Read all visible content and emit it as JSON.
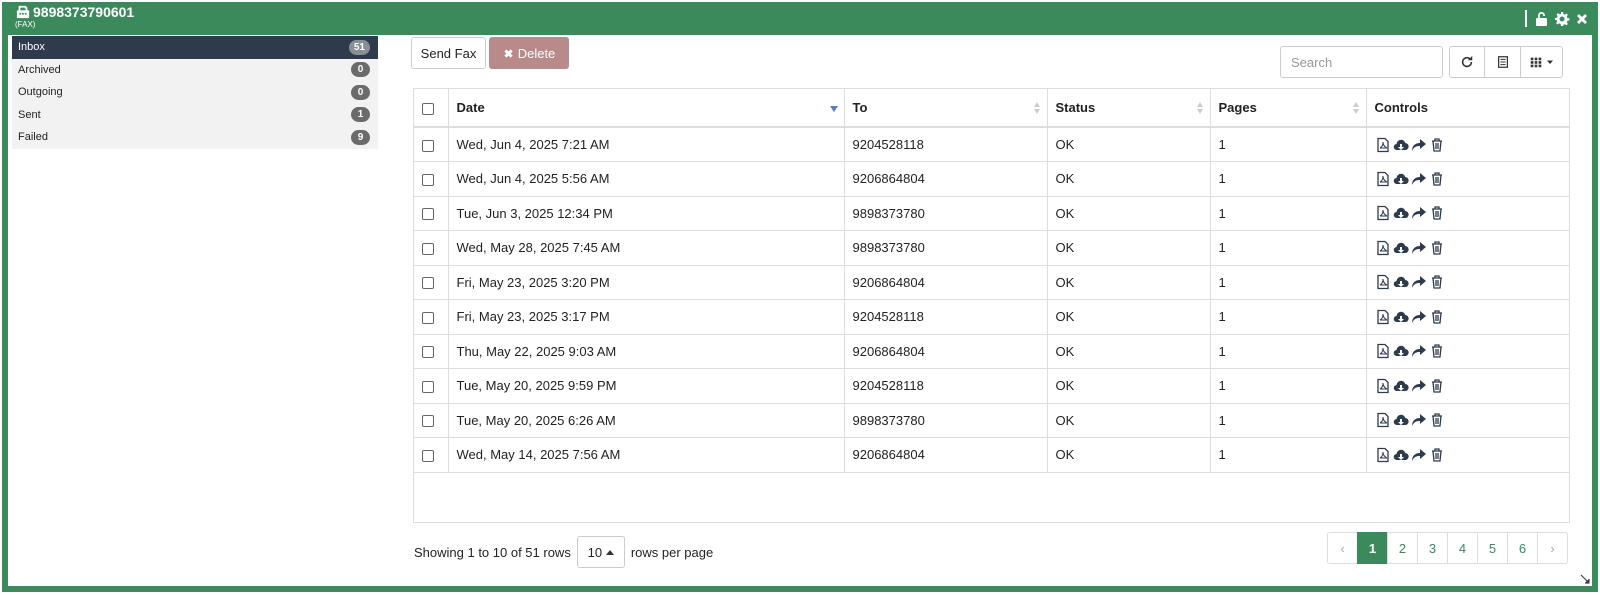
{
  "window": {
    "phone": "9898373790601",
    "subtitle": "(FAX)"
  },
  "sidebar": {
    "folders": [
      {
        "label": "Inbox",
        "count": "51"
      },
      {
        "label": "Archived",
        "count": "0"
      },
      {
        "label": "Outgoing",
        "count": "0"
      },
      {
        "label": "Sent",
        "count": "1"
      },
      {
        "label": "Failed",
        "count": "9"
      }
    ]
  },
  "toolbar": {
    "send_fax": "Send Fax",
    "delete": "Delete",
    "search_placeholder": "Search"
  },
  "table": {
    "headers": [
      "Date",
      "To",
      "Status",
      "Pages",
      "Controls"
    ],
    "rows": [
      {
        "date": "Wed, Jun 4, 2025 7:21 AM",
        "to": "9204528118",
        "status": "OK",
        "pages": "1"
      },
      {
        "date": "Wed, Jun 4, 2025 5:56 AM",
        "to": "9206864804",
        "status": "OK",
        "pages": "1"
      },
      {
        "date": "Tue, Jun 3, 2025 12:34 PM",
        "to": "9898373780",
        "status": "OK",
        "pages": "1"
      },
      {
        "date": "Wed, May 28, 2025 7:45 AM",
        "to": "9898373780",
        "status": "OK",
        "pages": "1"
      },
      {
        "date": "Fri, May 23, 2025 3:20 PM",
        "to": "9206864804",
        "status": "OK",
        "pages": "1"
      },
      {
        "date": "Fri, May 23, 2025 3:17 PM",
        "to": "9204528118",
        "status": "OK",
        "pages": "1"
      },
      {
        "date": "Thu, May 22, 2025 9:03 AM",
        "to": "9206864804",
        "status": "OK",
        "pages": "1"
      },
      {
        "date": "Tue, May 20, 2025 9:59 PM",
        "to": "9204528118",
        "status": "OK",
        "pages": "1"
      },
      {
        "date": "Tue, May 20, 2025 6:26 AM",
        "to": "9898373780",
        "status": "OK",
        "pages": "1"
      },
      {
        "date": "Wed, May 14, 2025 7:56 AM",
        "to": "9206864804",
        "status": "OK",
        "pages": "1"
      }
    ]
  },
  "pager": {
    "showing": "Showing 1 to 10 of 51 rows",
    "rows_per_page_value": "10",
    "rows_per_page_label": "rows per page",
    "prev": "‹",
    "next": "›",
    "pages": [
      "1",
      "2",
      "3",
      "4",
      "5",
      "6"
    ],
    "active_page": "1"
  },
  "colors": {
    "accent": "#3a8a5c",
    "sidebar_active": "#2f3b4c",
    "delete_button": "#b98a8a"
  }
}
